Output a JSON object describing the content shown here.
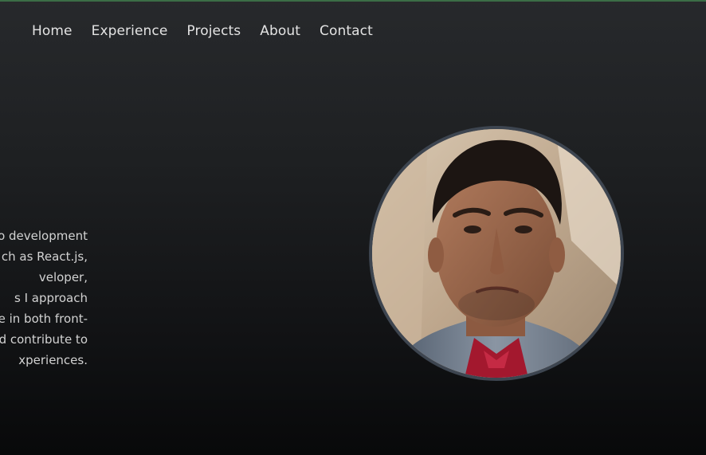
{
  "nav": {
    "items": [
      {
        "label": "Home"
      },
      {
        "label": "Experience"
      },
      {
        "label": "Projects"
      },
      {
        "label": "About"
      },
      {
        "label": "Contact"
      }
    ]
  },
  "hero": {
    "bio_lines": [
      "o development",
      "ch as React.js,",
      "veloper,",
      "s I approach",
      "e in both front-",
      "d contribute to",
      "xperiences."
    ],
    "profile_photo_alt": "profile photo"
  },
  "colors": {
    "accent": "#3b6d47",
    "background_top": "#27292c",
    "background_bottom": "#08090a",
    "text": "#e3e3e3",
    "avatar_border": "#3d4550"
  }
}
